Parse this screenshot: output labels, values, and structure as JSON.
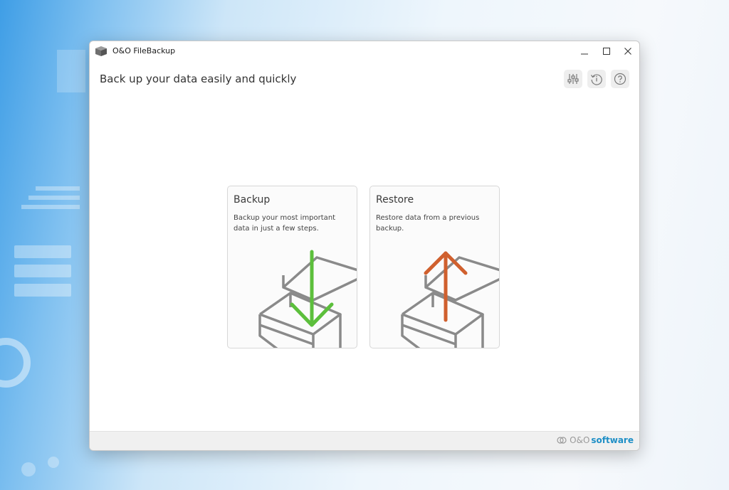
{
  "window": {
    "title": "O&O FileBackup"
  },
  "header": {
    "subtitle": "Back up your data easily and quickly"
  },
  "toolbar": {
    "icons": [
      "settings-sliders-icon",
      "history-icon",
      "help-icon"
    ]
  },
  "cards": [
    {
      "title": "Backup",
      "description": "Backup your most important data in just a few steps.",
      "arrow_color": "#5cbf3c",
      "arrow_direction": "down"
    },
    {
      "title": "Restore",
      "description": "Restore data from a previous backup.",
      "arrow_color": "#d0602e",
      "arrow_direction": "up"
    }
  ],
  "footer": {
    "brand_prefix": "O&O",
    "brand_name": "software"
  },
  "colors": {
    "accent": "#1f8fc6",
    "box_stroke": "#8a8a8a"
  }
}
